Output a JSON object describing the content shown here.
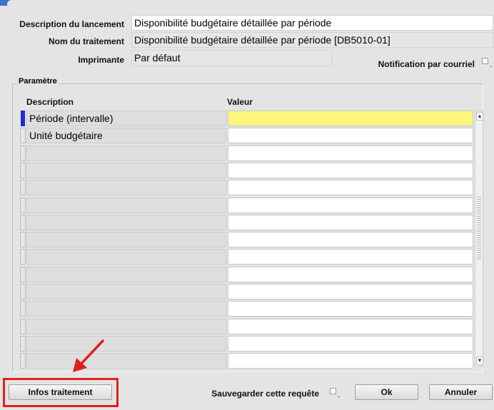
{
  "header": {
    "launch_description_label": "Description du lancement",
    "launch_description_value": "Disponibilité budgétaire détaillée par période",
    "process_name_label": "Nom du traitement",
    "process_name_value": "Disponibilité budgétaire détaillée par période [DB5010-01]",
    "printer_label": "Imprimante",
    "printer_value": "Par défaut",
    "email_notification_label": "Notification par courriel",
    "email_notification_checked": false
  },
  "parameters": {
    "group_title": "Paramètre",
    "col_description": "Description",
    "col_value": "Valeur",
    "rows": [
      {
        "description": "Période (intervalle)",
        "value": "",
        "active": true
      },
      {
        "description": "Unité budgétaire",
        "value": ""
      },
      {
        "description": "",
        "value": ""
      },
      {
        "description": "",
        "value": ""
      },
      {
        "description": "",
        "value": ""
      },
      {
        "description": "",
        "value": ""
      },
      {
        "description": "",
        "value": ""
      },
      {
        "description": "",
        "value": ""
      },
      {
        "description": "",
        "value": ""
      },
      {
        "description": "",
        "value": ""
      },
      {
        "description": "",
        "value": ""
      },
      {
        "description": "",
        "value": ""
      },
      {
        "description": "",
        "value": ""
      },
      {
        "description": "",
        "value": ""
      },
      {
        "description": "",
        "value": ""
      }
    ]
  },
  "footer": {
    "process_info_button": "Infos traitement",
    "save_query_label": "Sauvegarder cette requête",
    "save_query_checked": false,
    "ok_button": "Ok",
    "cancel_button": "Annuler"
  },
  "colors": {
    "active_field": "#fcf67a",
    "row_indicator": "#1d2bd6",
    "annotation": "#e02020"
  }
}
